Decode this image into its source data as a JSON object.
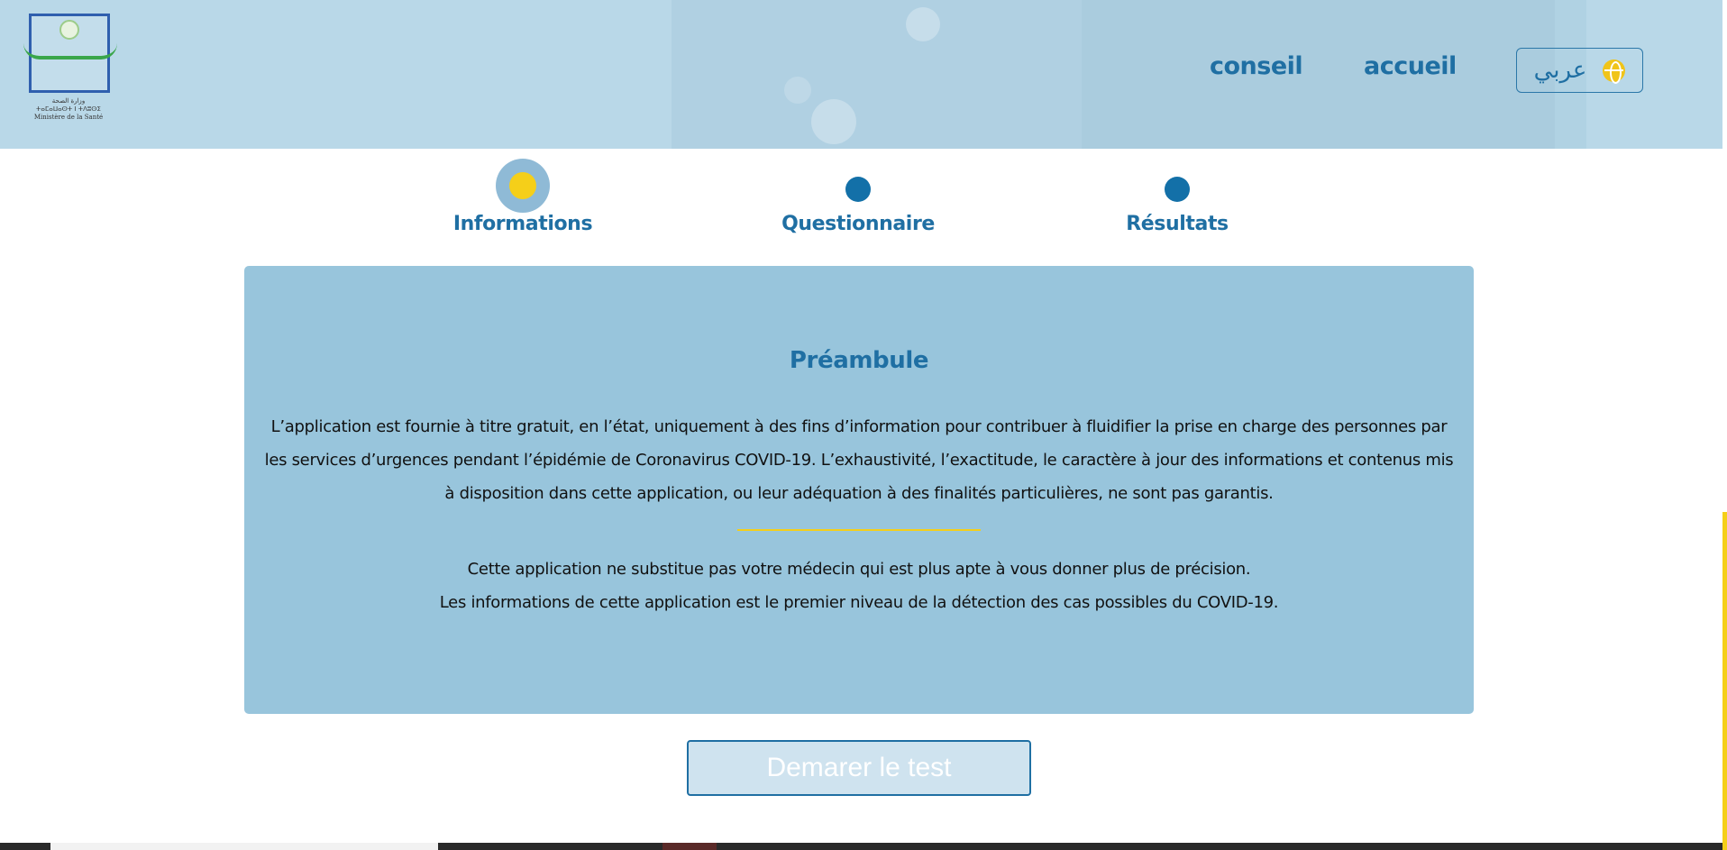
{
  "header": {
    "logo_text_arabic": "وزارة الصحة",
    "logo_text_tifinagh": "ⵜⴰⵎⴰⵡⴰⵙⵜ ⵏ ⵜⴷⵓⵙⵉ",
    "logo_text_french": "Ministère de la Santé",
    "nav": {
      "conseil": "conseil",
      "accueil": "accueil",
      "language_label": "عربي"
    }
  },
  "stepper": {
    "steps": [
      {
        "label": "Informations",
        "active": true
      },
      {
        "label": "Questionnaire",
        "active": false
      },
      {
        "label": "Résultats",
        "active": false
      }
    ]
  },
  "card": {
    "title": "Préambule",
    "paragraph1": "L’application est fournie à titre gratuit, en l’état, uniquement à des fins d’information pour contribuer à fluidifier la prise en charge des personnes par les services d’urgences pendant l’épidémie de Coronavirus COVID-19. L’exhaustivité, l’exactitude, le caractère à jour des informations et contenus mis à disposition dans cette application, ou leur adéquation à des finalités particulières, ne sont pas garantis.",
    "paragraph2_line1": "Cette application ne substitue pas votre médecin qui est plus apte à vous donner plus de précision.",
    "paragraph2_line2": "Les informations de cette application est le premier niveau de la détection des cas possibles du COVID-19."
  },
  "start_button": "Demarer le test",
  "colors": {
    "header_bg": "#b9d8e8",
    "primary": "#1f6fa3",
    "accent_yellow": "#f5cf19",
    "card_bg": "#98c5dc"
  },
  "icons": {
    "language": "globe-icon"
  }
}
